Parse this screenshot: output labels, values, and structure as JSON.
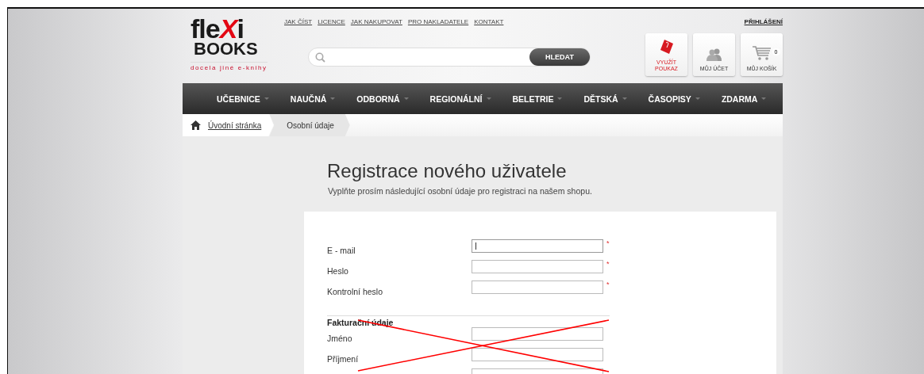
{
  "logo": {
    "word_start": "fle",
    "word_accent": "X",
    "word_end": "i",
    "line_2": "BOOKS",
    "tagline": "docela jiné e-knihy"
  },
  "top_links": [
    "JAK ČÍST",
    "LICENCE",
    "JAK NAKUPOVAT",
    "PRO NAKLADATELE",
    "KONTAKT"
  ],
  "login_link": "PŘIHLÁŠENÍ",
  "search": {
    "button": "HLEDAT"
  },
  "header_buttons": [
    {
      "kind": "voucher",
      "label_1": "VYUŽÍT",
      "label_2": "POUKAZ"
    },
    {
      "kind": "account",
      "label_1": "MŮJ ÚČET"
    },
    {
      "kind": "cart",
      "label_1": "MŮJ KOŠÍK",
      "count": "0"
    }
  ],
  "nav": [
    "UČEBNICE",
    "NAUČNÁ",
    "ODBORNÁ",
    "REGIONÁLNÍ",
    "BELETRIE",
    "DĚTSKÁ",
    "ČASOPISY",
    "ZDARMA"
  ],
  "breadcrumb": [
    {
      "label": "Úvodní stránka",
      "kind": "home"
    },
    {
      "label": "Osobní údaje",
      "kind": "current"
    }
  ],
  "page": {
    "title": "Registrace nového uživatele",
    "subtitle": "Vyplňte prosím následující osobní údaje pro registraci na našem shopu."
  },
  "form": {
    "sections": [
      {
        "fields": [
          {
            "label": "E - mail",
            "required_mark": "*",
            "focused": true
          },
          {
            "label": "Heslo",
            "required_mark": "*",
            "focused": false
          },
          {
            "label": "Kontrolní heslo",
            "required_mark": "*",
            "focused": false
          }
        ]
      },
      {
        "heading": "Fakturační údaje",
        "fields": [
          {
            "label": "Jméno",
            "focused": false
          },
          {
            "label": "Příjmení",
            "focused": false
          },
          {
            "focused": false
          }
        ]
      }
    ]
  },
  "annotation": {
    "kind": "cross"
  }
}
